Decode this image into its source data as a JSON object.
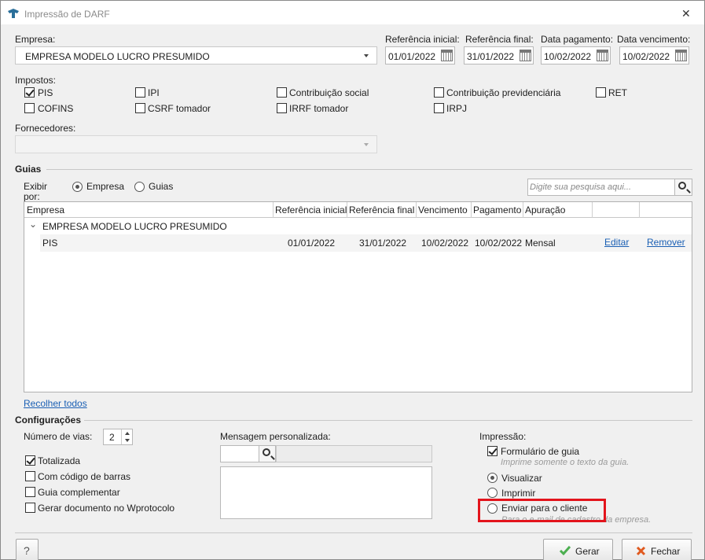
{
  "window": {
    "title": "Impressão de DARF",
    "close_glyph": "✕"
  },
  "header": {
    "empresa_label": "Empresa:",
    "empresa_value": "EMPRESA MODELO LUCRO PRESUMIDO",
    "ref_inicial_label": "Referência inicial:",
    "ref_inicial_value": "01/01/2022",
    "ref_final_label": "Referência final:",
    "ref_final_value": "31/01/2022",
    "data_pagamento_label": "Data pagamento:",
    "data_pagamento_value": "10/02/2022",
    "data_vencimento_label": "Data vencimento:",
    "data_vencimento_value": "10/02/2022"
  },
  "impostos": {
    "label": "Impostos:",
    "items": [
      {
        "label": "PIS",
        "checked": true
      },
      {
        "label": "IPI",
        "checked": false
      },
      {
        "label": "Contribuição social",
        "checked": false
      },
      {
        "label": "Contribuição previdenciária",
        "checked": false
      },
      {
        "label": "RET",
        "checked": false
      },
      {
        "label": "COFINS",
        "checked": false
      },
      {
        "label": "CSRF tomador",
        "checked": false
      },
      {
        "label": "IRRF tomador",
        "checked": false
      },
      {
        "label": "IRPJ",
        "checked": false
      }
    ]
  },
  "fornecedores": {
    "label": "Fornecedores:",
    "value": ""
  },
  "guias": {
    "section_title": "Guias",
    "exibir_por_label": "Exibir por:",
    "radio_empresa": "Empresa",
    "radio_guias": "Guias",
    "search_placeholder": "Digite sua pesquisa aqui...",
    "columns": [
      "Empresa",
      "Referência inicial",
      "Referência final",
      "Vencimento",
      "Pagamento",
      "Apuração"
    ],
    "group": {
      "collapse_glyph": "⌄",
      "name": "EMPRESA MODELO LUCRO PRESUMIDO"
    },
    "row": {
      "imposto": "PIS",
      "ref_inicial": "01/01/2022",
      "ref_final": "31/01/2022",
      "vencimento": "10/02/2022",
      "pagamento": "10/02/2022",
      "apuracao": "Mensal",
      "edit_link": "Editar",
      "remove_link": "Remover"
    },
    "collapse_all_link": "Recolher todos"
  },
  "configuracoes": {
    "section_title": "Configurações",
    "numero_vias_label": "Número de vias:",
    "numero_vias_value": "2",
    "totalizada": "Totalizada",
    "codigo_barras": "Com código de barras",
    "guia_complementar": "Guia complementar",
    "gerar_wprotocolo": "Gerar documento no Wprotocolo",
    "mensagem_label": "Mensagem personalizada:",
    "impressao_label": "Impressão:",
    "formulario_guia": "Formulário de guia",
    "formulario_hint": "Imprime somente o texto da guia.",
    "visualizar": "Visualizar",
    "imprimir": "Imprimir",
    "enviar_cliente": "Enviar para o cliente",
    "enviar_hint": "Para o e-mail de cadastro da empresa."
  },
  "footer": {
    "help_glyph": "?",
    "gerar_label": "Gerar",
    "fechar_label": "Fechar"
  },
  "colors": {
    "link": "#1a5fb4",
    "highlight": "#e3141c",
    "gerar_icon": "#4caf50",
    "fechar_icon": "#e05a20"
  }
}
